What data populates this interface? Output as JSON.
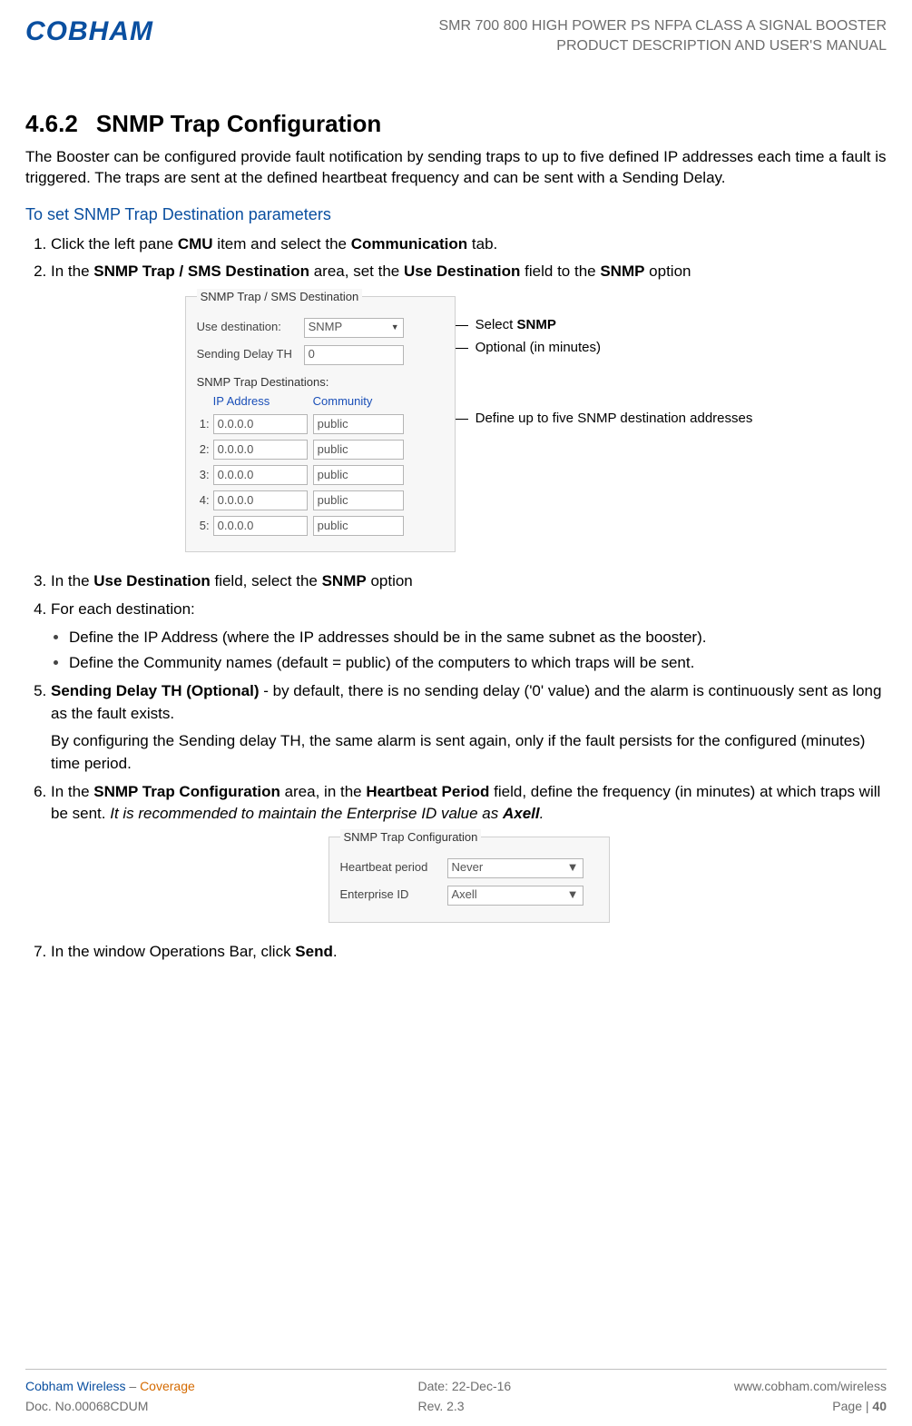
{
  "header": {
    "logo": "COBHAM",
    "line1": "SMR 700 800 HIGH POWER PS NFPA CLASS A SIGNAL BOOSTER",
    "line2": "PRODUCT DESCRIPTION AND USER'S MANUAL"
  },
  "section": {
    "num": "4.6.2",
    "title": "SNMP Trap Configuration",
    "intro": "The Booster can be configured provide fault notification by sending traps to up to five defined IP addresses each time a fault is triggered. The traps are sent at the defined heartbeat frequency and can be sent with a Sending Delay.",
    "sub": "To set SNMP Trap Destination parameters"
  },
  "steps": {
    "s1_a": "Click the left pane ",
    "s1_b": "CMU",
    "s1_c": " item and select the ",
    "s1_d": "Communication",
    "s1_e": " tab.",
    "s2_a": "In the ",
    "s2_b": "SNMP Trap / SMS Destination",
    "s2_c": " area, set the ",
    "s2_d": "Use Destination",
    "s2_e": " field to the ",
    "s2_f": "SNMP",
    "s2_g": " option",
    "s3_a": "In the ",
    "s3_b": "Use Destination",
    "s3_c": " field, select the ",
    "s3_d": "SNMP",
    "s3_e": " option",
    "s4": "For each destination:",
    "s4b1": "Define the IP Address (where the IP addresses should be in the same subnet as the booster).",
    "s4b2": "Define the Community names (default = public) of the computers to which traps will be sent.",
    "s5_a": "Sending Delay TH (Optional)",
    "s5_b": " -  by default, there is no sending delay ('0' value) and the alarm is continuously sent as long as the fault exists.",
    "s5_p2": "By configuring the Sending delay TH, the same alarm is sent again, only if the fault persists for the configured (minutes) time period.",
    "s6_a": "In the ",
    "s6_b": "SNMP Trap Configuration",
    "s6_c": " area, in the ",
    "s6_d": "Heartbeat Period",
    "s6_e": " field, define the frequency (in minutes) at which traps will be sent. ",
    "s6_f": "It is recommended to maintain the Enterprise ID value as ",
    "s6_g": "Axell",
    "s6_h": ".",
    "s7_a": "In the window Operations Bar, click ",
    "s7_b": "Send",
    "s7_c": "."
  },
  "panel1": {
    "title": "SNMP Trap / SMS Destination",
    "use_dest_label": "Use destination:",
    "use_dest_value": "SNMP",
    "delay_label": "Sending Delay TH",
    "delay_value": "0",
    "sub": "SNMP Trap Destinations:",
    "col_ip": "IP Address",
    "col_comm": "Community",
    "rows": [
      {
        "n": "1:",
        "ip": "0.0.0.0",
        "comm": "public"
      },
      {
        "n": "2:",
        "ip": "0.0.0.0",
        "comm": "public"
      },
      {
        "n": "3:",
        "ip": "0.0.0.0",
        "comm": "public"
      },
      {
        "n": "4:",
        "ip": "0.0.0.0",
        "comm": "public"
      },
      {
        "n": "5:",
        "ip": "0.0.0.0",
        "comm": "public"
      }
    ]
  },
  "ann": {
    "a1_a": "Select ",
    "a1_b": "SNMP",
    "a2": "Optional (in minutes)",
    "a3": "Define up to five SNMP destination addresses"
  },
  "panel2": {
    "title": "SNMP Trap Configuration",
    "hb_label": "Heartbeat period",
    "hb_value": "Never",
    "eid_label": "Enterprise ID",
    "eid_value": "Axell"
  },
  "footer": {
    "brand": "Cobham Wireless",
    "dash": " – ",
    "cov": "Coverage",
    "doc": "Doc. No.00068CDUM",
    "date": "Date: 22-Dec-16",
    "rev": "Rev. 2.3",
    "url": "www.cobham.com/wireless",
    "page_a": "Page | ",
    "page_b": "40"
  }
}
